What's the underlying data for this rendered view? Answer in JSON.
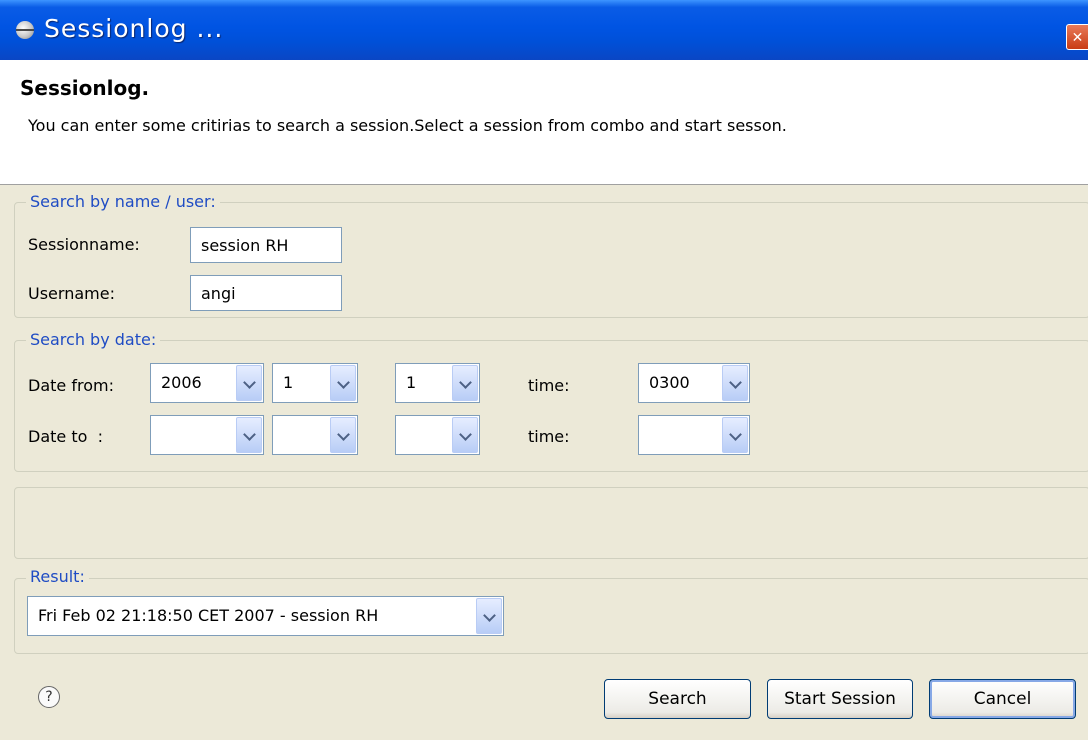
{
  "window": {
    "title": "Sessionlog ...",
    "close_symbol": "✕",
    "icon": "eclipse-globe-icon"
  },
  "banner": {
    "title": "Sessionlog.",
    "description": "You can enter some critirias to search a session.Select a session from combo and start sesson."
  },
  "name_group": {
    "label": "Search by name / user:",
    "sessionname_label": "Sessionname:",
    "sessionname_value": "session RH",
    "username_label": "Username:",
    "username_value": "angi"
  },
  "date_group": {
    "label": "Search by date:",
    "from_label": "Date from:",
    "from_year": "2006",
    "from_month": "1",
    "from_day": "1",
    "from_time_label": "time:",
    "from_time": "0300",
    "to_label": "Date to  :",
    "to_year": "",
    "to_month": "",
    "to_day": "",
    "to_time_label": "time:",
    "to_time": ""
  },
  "result_group": {
    "label": "Result:",
    "selected": "Fri Feb 02 21:18:50 CET 2007 - session RH"
  },
  "footer": {
    "help_symbol": "?",
    "search_label": "Search",
    "start_label": "Start Session",
    "cancel_label": "Cancel"
  },
  "colors": {
    "titlebar": "#0054e3",
    "group_label": "#1f4cc4",
    "dialog_bg": "#ece9d8"
  }
}
